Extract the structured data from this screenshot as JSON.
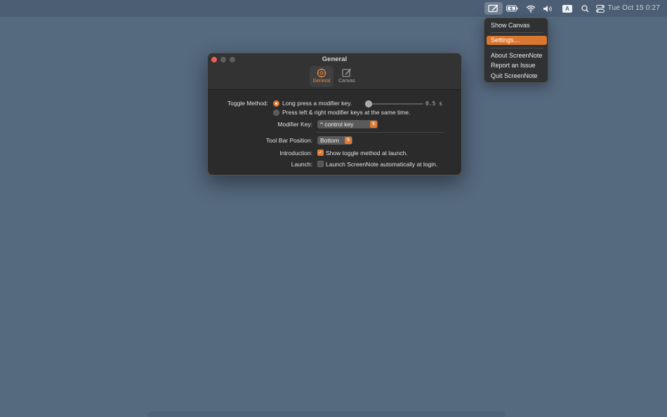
{
  "menubar": {
    "input_source_label": "A",
    "clock": "Tue Oct 15  0:27"
  },
  "menu": {
    "items": [
      "Show Canvas",
      "Settings…",
      "About ScreenNote",
      "Report an Issue",
      "Quit ScreenNote"
    ],
    "highlighted": "Settings…"
  },
  "window": {
    "title": "General",
    "tabs": [
      {
        "label": "General",
        "icon": "gear-icon",
        "active": true
      },
      {
        "label": "Canvas",
        "icon": "pencil-square-icon",
        "active": false
      }
    ],
    "toggle_method": {
      "label": "Toggle Method:",
      "options": [
        "Long press a modifier key.",
        "Press left & right modifier keys at the same time."
      ],
      "selected_index": 0,
      "duration_value": "0.5 s"
    },
    "modifier_key": {
      "label": "Modifier Key:",
      "value": "^ control key"
    },
    "toolbar_position": {
      "label": "Tool Bar Position:",
      "value": "Bottom"
    },
    "introduction": {
      "label": "Introduction:",
      "checkbox_text": "Show toggle method at launch.",
      "checked": true
    },
    "launch": {
      "label": "Launch:",
      "checkbox_text": "Launch ScreenNote automatically at login.",
      "checked": false
    }
  },
  "colors": {
    "accent": "#e07a35",
    "desktop": "#55697f",
    "window_bg": "#2b2b2b"
  }
}
